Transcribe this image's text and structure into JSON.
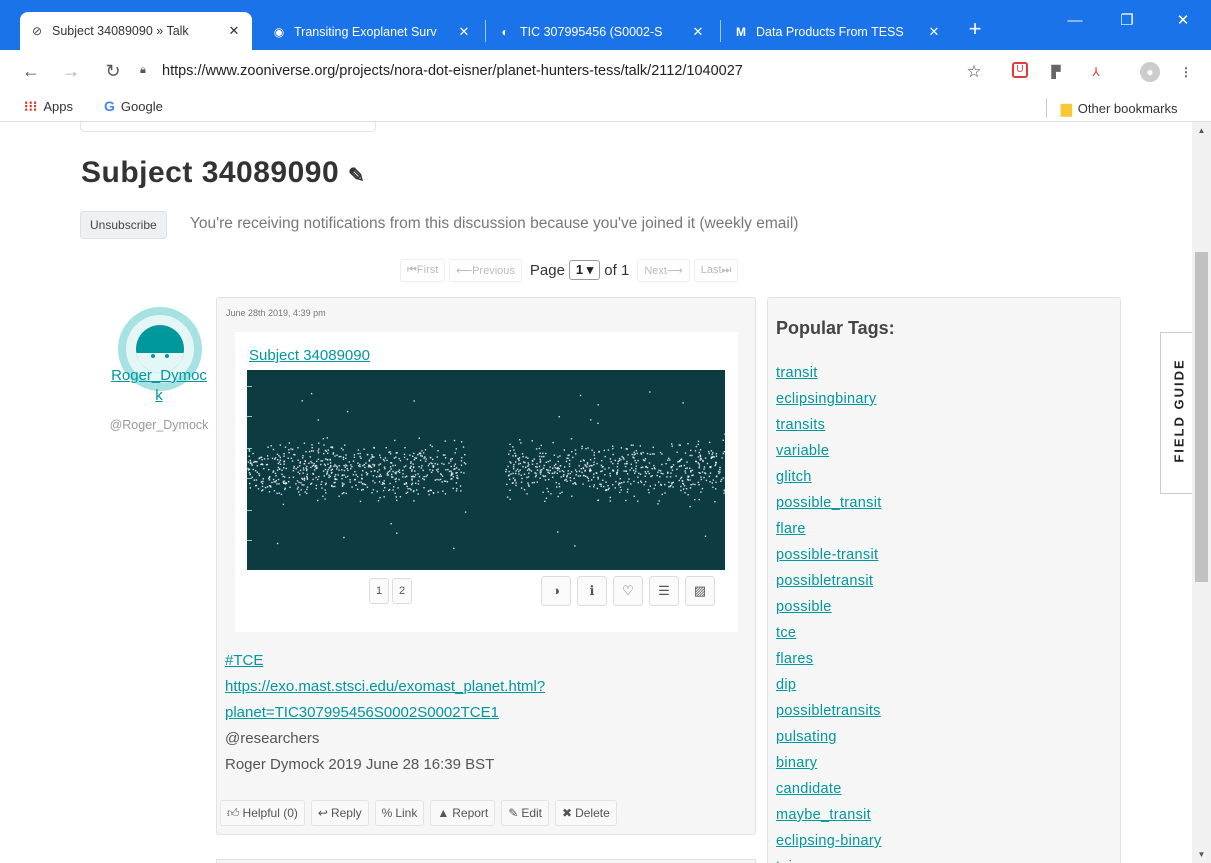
{
  "browser": {
    "tabs": [
      {
        "title": "Subject 34089090 » Talk",
        "active": true
      },
      {
        "title": "Transiting Exoplanet Surv",
        "active": false
      },
      {
        "title": "TIC 307995456 (S0002-S",
        "active": false
      },
      {
        "title": "Data Products From TESS",
        "active": false
      }
    ],
    "url": "https://www.zooniverse.org/projects/nora-dot-eisner/planet-hunters-tess/talk/2112/1040027",
    "bookmarks": {
      "apps": "Apps",
      "google": "Google",
      "other": "Other bookmarks"
    }
  },
  "page": {
    "title": "Subject 34089090",
    "unsubscribe_label": "Unsubscribe",
    "notice": "You're receiving notifications from this discussion because you've joined it (weekly email)",
    "pager": {
      "first": "First",
      "previous": "Previous",
      "page_label": "Page",
      "current": "1",
      "of_label": "of 1",
      "next": "Next",
      "last": "Last"
    },
    "author": {
      "name_line1": "Roger_Dymoc",
      "name_line2": "k",
      "handle": "@Roger_Dymock"
    },
    "comment": {
      "date": "June 28th 2019, 4:39 pm",
      "subject_link": "Subject 34089090",
      "frames": [
        "1",
        "2"
      ],
      "body": {
        "tag": "#TCE",
        "url_line1": "https://exo.mast.stsci.edu/exomast_planet.html?",
        "url_line2": "planet=TIC307995456S0002S0002TCE1",
        "mention": "@researchers",
        "signature": "Roger Dymock 2019 June 28 16:39 BST"
      },
      "actions": {
        "helpful": "Helpful (0)",
        "reply": "Reply",
        "link": "Link",
        "report": "Report",
        "edit": "Edit",
        "delete": "Delete"
      }
    },
    "popular_tags_title": "Popular Tags:",
    "popular_tags": [
      "transit",
      "eclipsingbinary",
      "transits",
      "variable",
      "glitch",
      "possible_transit",
      "flare",
      "possible-transit",
      "possibletransit",
      "possible",
      "tce",
      "flares",
      "dip",
      "possibletransits",
      "pulsating",
      "binary",
      "candidate",
      "maybe_transit",
      "eclipsing-binary",
      "toi"
    ],
    "field_guide": "FIELD GUIDE"
  },
  "colors": {
    "accent": "#00979d",
    "chrome": "#1a73e8",
    "plot_bg": "#0c3b42"
  }
}
